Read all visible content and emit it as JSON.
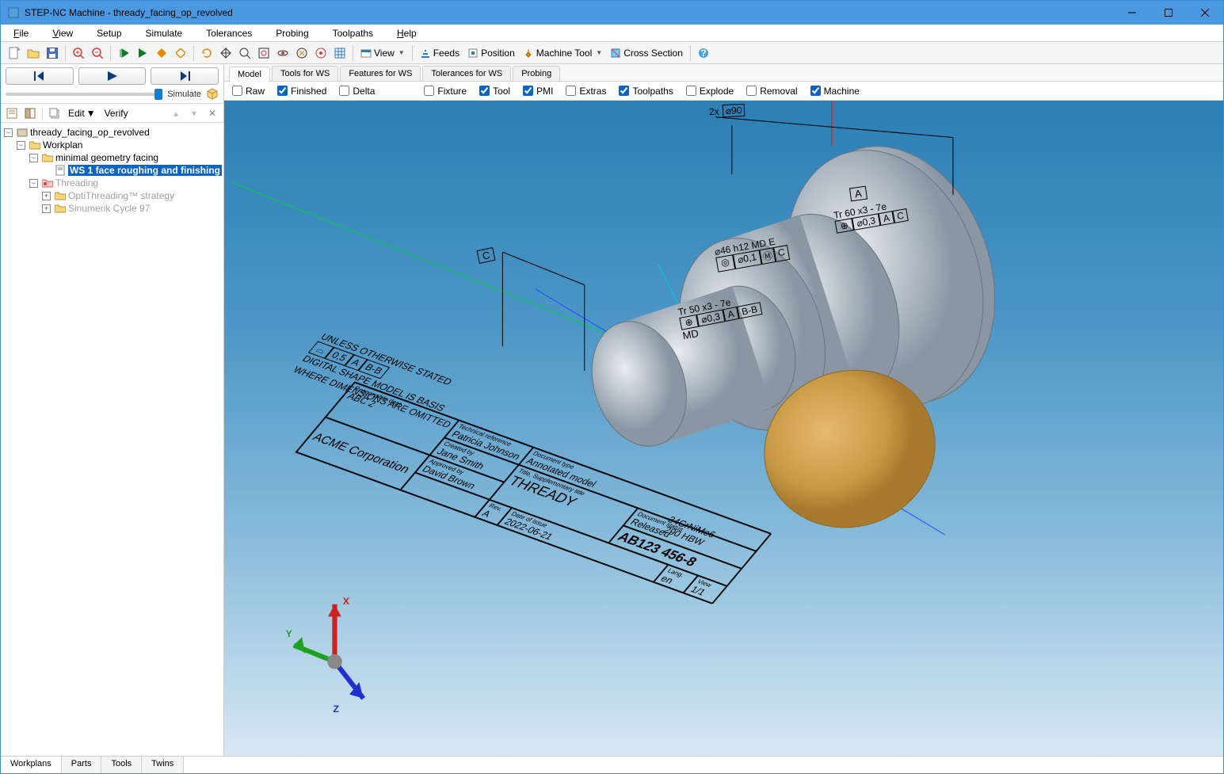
{
  "titlebar": {
    "app": "STEP-NC Machine",
    "document": "thready_facing_op_revolved"
  },
  "menus": {
    "file": "File",
    "view": "View",
    "setup": "Setup",
    "simulate": "Simulate",
    "tolerances": "Tolerances",
    "probing": "Probing",
    "toolpaths": "Toolpaths",
    "help": "Help"
  },
  "toolbar": {
    "view": "View",
    "feeds": "Feeds",
    "position": "Position",
    "machine_tool": "Machine Tool",
    "cross_section": "Cross Section"
  },
  "sim": {
    "label": "Simulate"
  },
  "tree_toolbar": {
    "edit": "Edit",
    "verify": "Verify"
  },
  "tree": {
    "root": "thready_facing_op_revolved",
    "workplan": "Workplan",
    "minimal": "minimal geometry facing",
    "ws1": "WS 1 face roughing and finishing",
    "threading": "Threading",
    "opti": "OptiThreading™ strategy",
    "sinumerik": "Sinumerik Cycle 97"
  },
  "bottom_tabs": {
    "workplans": "Workplans",
    "parts": "Parts",
    "tools": "Tools",
    "twins": "Twins"
  },
  "view_tabs": {
    "model": "Model",
    "tools_ws": "Tools for WS",
    "features_ws": "Features for WS",
    "tolerances_ws": "Tolerances for WS",
    "probing": "Probing"
  },
  "view_checks": {
    "raw": "Raw",
    "finished": "Finished",
    "delta": "Delta",
    "fixture": "Fixture",
    "tool": "Tool",
    "pmi": "PMI",
    "extras": "Extras",
    "toolpaths": "Toolpaths",
    "explode": "Explode",
    "removal": "Removal",
    "machine": "Machine"
  },
  "pmi": {
    "dia90_prefix": "2x",
    "dia90": "⌀90",
    "datum_a_top": "A",
    "tr60": "Tr 60  x3 - 7e",
    "fcf1_sym": "⊕",
    "fcf1_tol": "⌀0,3",
    "fcf1_d1": "A",
    "fcf1_d2": "C",
    "datum_c": "C",
    "dia46": "⌀46  h12",
    "md_e": "MD E",
    "fcf2_sym": "◎",
    "fcf2_tol": "⌀0,1",
    "fcf2_m": "Ⓜ",
    "fcf2_d": "C",
    "tr50": "Tr 50  x3 - 7e",
    "fcf3_sym": "⊕",
    "fcf3_tol": "⌀0,3",
    "fcf3_d1": "A",
    "fcf3_d2": "B-B",
    "md": "MD",
    "note1": "UNLESS OTHERWISE STATED",
    "note_prof": "⌓",
    "note_tol": "0,5",
    "note_d1": "A",
    "note_d2": "B-B",
    "note2": "DIGITAL SHAPE MODEL IS BASIS",
    "note3": "WHERE DIMENSIONS ARE OMITTED",
    "material1": "34CrNiMo6",
    "material2": "290 HBW"
  },
  "title_block": {
    "resp_dept_h": "Responsible dept.",
    "resp_dept": "ABC 2",
    "tech_ref_h": "Technical reference",
    "tech_ref": "Patricia Johnson",
    "doc_type_h": "Document type",
    "doc_type": "Annotated model",
    "created_h": "Created by",
    "created": "Jane Smith",
    "title_h": "Title, Supplementary title",
    "title": "THREADY",
    "company": "ACME Corporation",
    "approved_h": "Approved by",
    "approved": "David Brown",
    "status_h": "Document status",
    "status": "Released",
    "partno": "AB123 456-8",
    "rev_h": "Rev.",
    "rev": "A",
    "date_h": "Date of issue",
    "date": "2022-06-21",
    "lang_h": "Lang.",
    "lang": "en",
    "view_h": "View",
    "view": "1/1"
  },
  "axes": {
    "x": "X",
    "y": "Y",
    "z": "Z"
  }
}
